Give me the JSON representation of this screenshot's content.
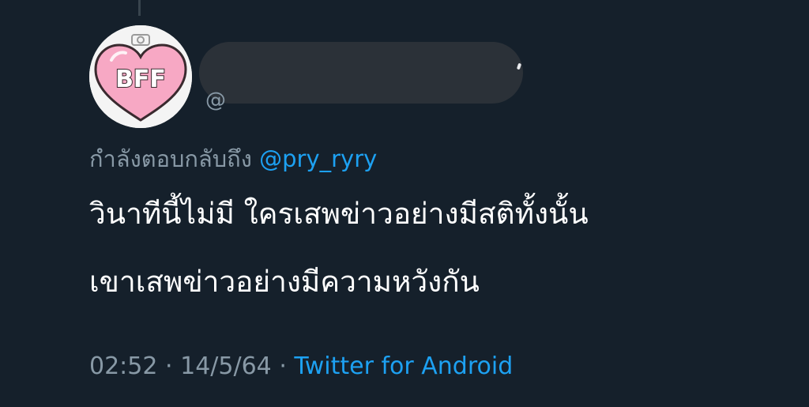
{
  "tweet": {
    "avatar_text": "BFF",
    "handle_partial": "@",
    "reply_prefix": "กำลังตอบกลับถึง",
    "reply_mention": "@pry_ryry",
    "text_lines": [
      "วินาทีนี้ไม่มี ใครเสพข่าวอย่างมีสติทั้งนั้น",
      "เขาเสพข่าวอย่างมีความหวังกัน"
    ],
    "time": "02:52",
    "separator": "·",
    "date": "14/5/64",
    "source": "Twitter for Android"
  },
  "colors": {
    "background": "#15202b",
    "text": "#ffffff",
    "secondary": "#8899a6",
    "link": "#1da1f2",
    "avatar_heart": "#f7a8c4",
    "avatar_text": "#ffffff"
  },
  "icons": {
    "avatar": "bff-heart-avatar"
  }
}
